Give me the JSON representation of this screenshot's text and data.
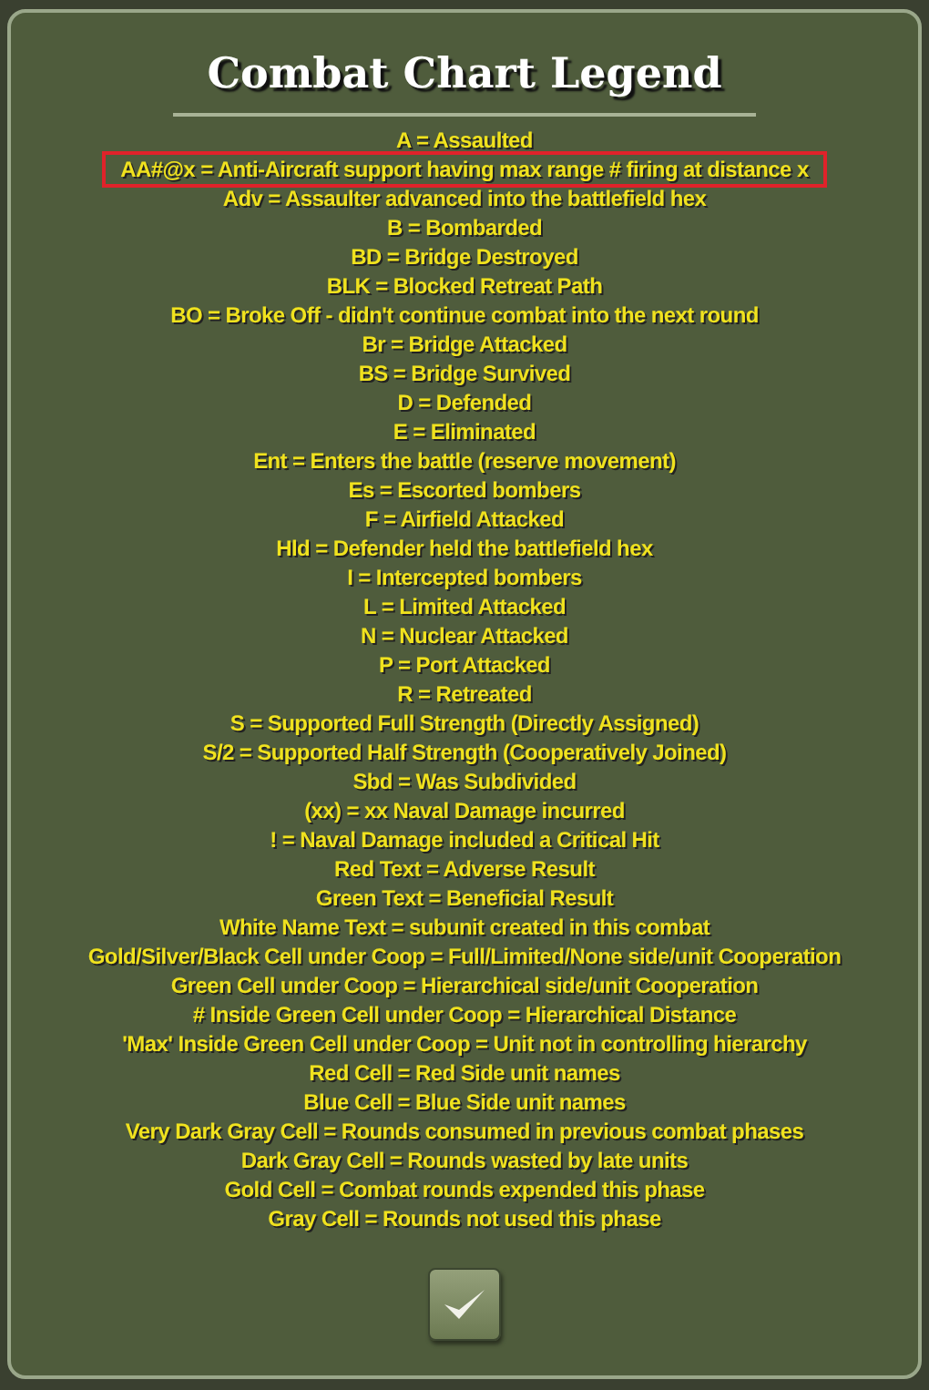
{
  "dialog": {
    "title": "Combat Chart Legend",
    "entries": [
      {
        "text": "A = Assaulted",
        "highlighted": false
      },
      {
        "text": "AA#@x = Anti-Aircraft support having max range # firing at distance x",
        "highlighted": true
      },
      {
        "text": "Adv = Assaulter advanced into the battlefield hex",
        "highlighted": false
      },
      {
        "text": "B = Bombarded",
        "highlighted": false
      },
      {
        "text": "BD = Bridge Destroyed",
        "highlighted": false
      },
      {
        "text": "BLK = Blocked Retreat Path",
        "highlighted": false
      },
      {
        "text": "BO = Broke Off - didn't continue combat into the next round",
        "highlighted": false
      },
      {
        "text": "Br = Bridge Attacked",
        "highlighted": false
      },
      {
        "text": "BS = Bridge Survived",
        "highlighted": false
      },
      {
        "text": "D = Defended",
        "highlighted": false
      },
      {
        "text": "E = Eliminated",
        "highlighted": false
      },
      {
        "text": "Ent = Enters the battle (reserve movement)",
        "highlighted": false
      },
      {
        "text": "Es = Escorted bombers",
        "highlighted": false
      },
      {
        "text": "F = Airfield Attacked",
        "highlighted": false
      },
      {
        "text": "Hld = Defender held the battlefield hex",
        "highlighted": false
      },
      {
        "text": "I = Intercepted bombers",
        "highlighted": false
      },
      {
        "text": "L = Limited Attacked",
        "highlighted": false
      },
      {
        "text": "N = Nuclear Attacked",
        "highlighted": false
      },
      {
        "text": "P = Port Attacked",
        "highlighted": false
      },
      {
        "text": "R = Retreated",
        "highlighted": false
      },
      {
        "text": "S = Supported Full Strength (Directly Assigned)",
        "highlighted": false
      },
      {
        "text": "S/2 = Supported Half Strength (Cooperatively Joined)",
        "highlighted": false
      },
      {
        "text": "Sbd = Was Subdivided",
        "highlighted": false
      },
      {
        "text": "(xx) = xx Naval Damage incurred",
        "highlighted": false
      },
      {
        "text": "! = Naval Damage included a Critical Hit",
        "highlighted": false
      },
      {
        "text": "Red Text = Adverse Result",
        "highlighted": false
      },
      {
        "text": "Green Text = Beneficial Result",
        "highlighted": false
      },
      {
        "text": "White Name Text = subunit created in this combat",
        "highlighted": false
      },
      {
        "text": "Gold/Silver/Black Cell under Coop = Full/Limited/None side/unit Cooperation",
        "highlighted": false
      },
      {
        "text": "Green Cell under Coop = Hierarchical side/unit Cooperation",
        "highlighted": false
      },
      {
        "text": "# Inside Green Cell under Coop = Hierarchical Distance",
        "highlighted": false
      },
      {
        "text": "'Max' Inside Green Cell under Coop = Unit not in controlling hierarchy",
        "highlighted": false
      },
      {
        "text": "Red Cell = Red Side unit names",
        "highlighted": false
      },
      {
        "text": "Blue Cell = Blue Side unit names",
        "highlighted": false
      },
      {
        "text": "Very Dark Gray Cell = Rounds consumed in previous combat phases",
        "highlighted": false
      },
      {
        "text": "Dark Gray Cell = Rounds wasted by late units",
        "highlighted": false
      },
      {
        "text": "Gold Cell = Combat rounds expended this phase",
        "highlighted": false
      },
      {
        "text": "Gray Cell = Rounds not used this phase",
        "highlighted": false
      }
    ]
  }
}
